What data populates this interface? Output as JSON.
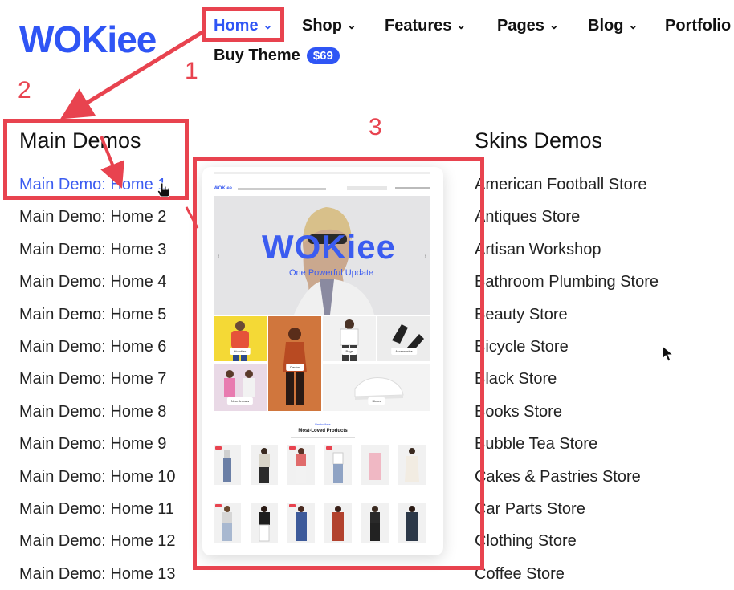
{
  "logo": {
    "text": "WOKiee",
    "color": "#2f55f5"
  },
  "nav": {
    "items": [
      {
        "label": "Home",
        "active": true
      },
      {
        "label": "Shop"
      },
      {
        "label": "Features"
      },
      {
        "label": "Pages"
      },
      {
        "label": "Blog"
      },
      {
        "label": "Portfolio"
      }
    ],
    "buy_theme": {
      "label": "Buy Theme",
      "badge": "$69"
    }
  },
  "menu": {
    "main_demos": {
      "title": "Main Demos",
      "items": [
        "Main Demo: Home 1",
        "Main Demo: Home 2",
        "Main Demo: Home 3",
        "Main Demo: Home 4",
        "Main Demo: Home 5",
        "Main Demo: Home 6",
        "Main Demo: Home 7",
        "Main Demo: Home 8",
        "Main Demo: Home 9",
        "Main Demo: Home 10",
        "Main Demo: Home 11",
        "Main Demo: Home 12",
        "Main Demo: Home 13"
      ]
    },
    "skins_demos": {
      "title": "Skins Demos",
      "items": [
        "American Football Store",
        "Antiques Store",
        "Artisan Workshop",
        "Bathroom Plumbing Store",
        "Beauty Store",
        "Bicycle Store",
        "Black Store",
        "Books Store",
        "Bubble Tea Store",
        "Cakes & Pastries Store",
        "Car Parts Store",
        "Clothing Store",
        "Coffee Store"
      ]
    }
  },
  "preview": {
    "hero_logo": "WOKiee",
    "hero_sub": "One Powerful Update",
    "section_kicker": "Bestsellers",
    "section_title": "Most-Loved Products",
    "tiles": [
      "Hoodies",
      "Denim",
      "Bags",
      "Accessories",
      "New Arrivals",
      "Shoes"
    ]
  },
  "annotations": {
    "n1": "1",
    "n2": "2",
    "n3": "3",
    "color": "#e8434f"
  }
}
